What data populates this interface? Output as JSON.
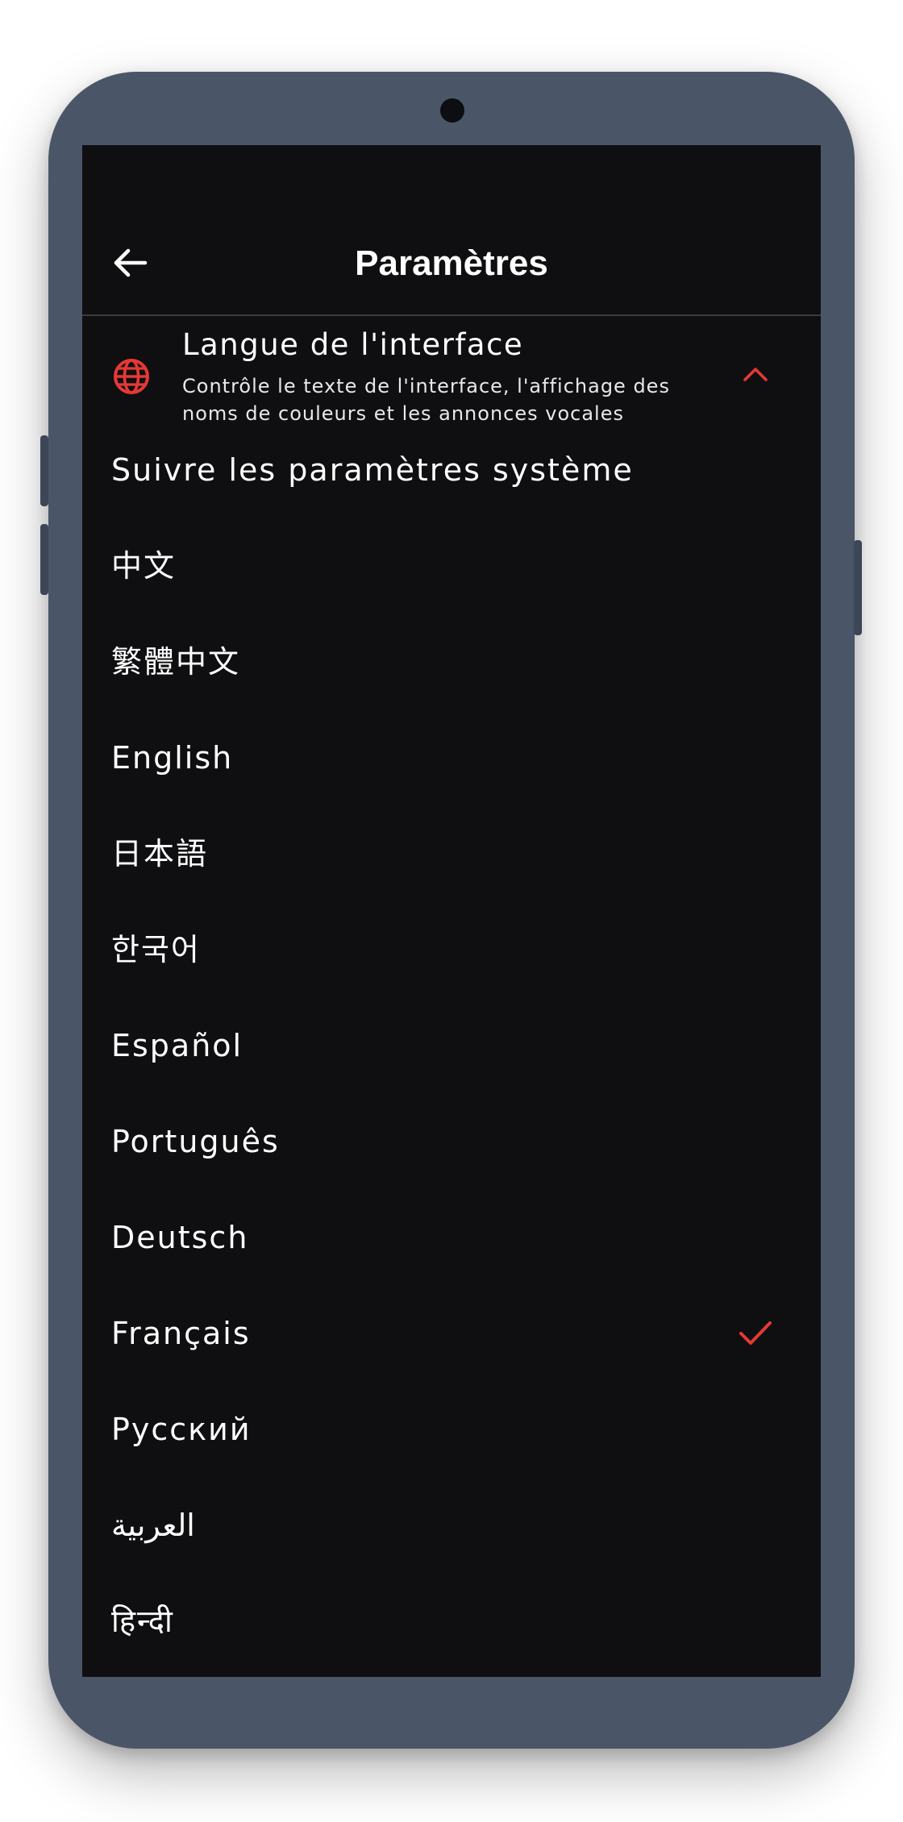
{
  "colors": {
    "accent": "#e53935",
    "screen_bg": "#0f0f11",
    "device_frame": "#4a5568",
    "text_primary": "#ffffff"
  },
  "header": {
    "title": "Paramètres",
    "back_icon": "arrow-left-icon"
  },
  "interface_language": {
    "title": "Langue de l'interface",
    "description": "Contrôle le texte de l'interface, l'affichage des noms de couleurs et les annonces vocales",
    "icon": "globe-icon",
    "expanded": true,
    "expand_icon": "chevron-up-icon"
  },
  "languages": [
    {
      "label": "Suivre les paramètres système",
      "selected": false
    },
    {
      "label": "中文",
      "selected": false
    },
    {
      "label": "繁體中文",
      "selected": false
    },
    {
      "label": "English",
      "selected": false
    },
    {
      "label": "日本語",
      "selected": false
    },
    {
      "label": "한국어",
      "selected": false
    },
    {
      "label": "Español",
      "selected": false
    },
    {
      "label": "Português",
      "selected": false
    },
    {
      "label": "Deutsch",
      "selected": false
    },
    {
      "label": "Français",
      "selected": true
    },
    {
      "label": "Русский",
      "selected": false
    },
    {
      "label": "العربية",
      "selected": false
    },
    {
      "label": "हिन्दी",
      "selected": false
    }
  ]
}
